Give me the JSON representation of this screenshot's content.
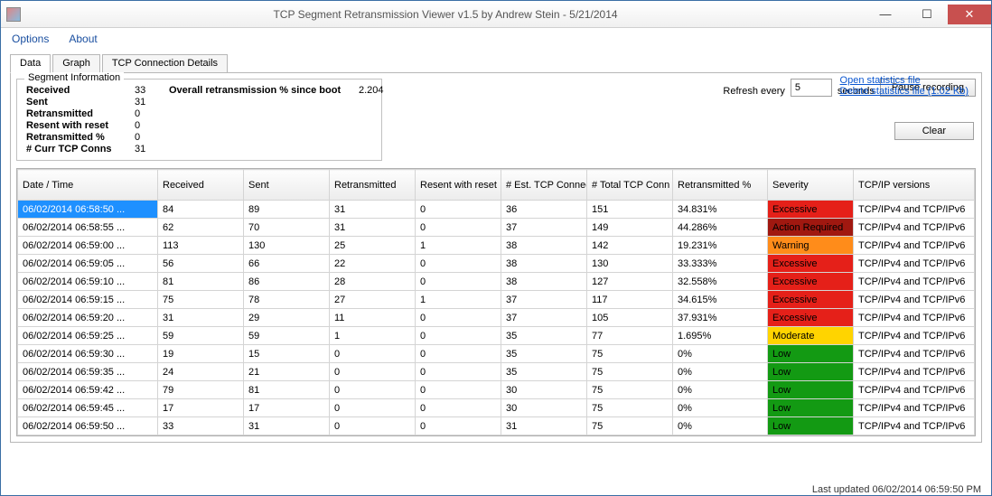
{
  "window": {
    "title": "TCP Segment Retransmission Viewer v1.5 by Andrew Stein - 5/21/2014"
  },
  "menu": {
    "options": "Options",
    "about": "About"
  },
  "tabs": {
    "data": "Data",
    "graph": "Graph",
    "details": "TCP Connection Details"
  },
  "segment_info": {
    "legend": "Segment Information",
    "labels": {
      "received": "Received",
      "sent": "Sent",
      "retransmitted": "Retransmitted",
      "resent_reset": "Resent with reset",
      "retrans_pct": "Retransmitted %",
      "curr_conns": "# Curr TCP Conns",
      "overall": "Overall retransmission % since boot"
    },
    "values": {
      "received": "33",
      "sent": "31",
      "retransmitted": "0",
      "resent_reset": "0",
      "retrans_pct": "0",
      "curr_conns": "31",
      "overall": "2.204"
    }
  },
  "refresh": {
    "label_pre": "Refresh every",
    "value": "5",
    "label_post": "seconds",
    "pause": "Pause recording"
  },
  "links": {
    "open": "Open statistics file",
    "delete": "Delete statistics file (1.02 Kb)"
  },
  "buttons": {
    "clear": "Clear"
  },
  "columns": {
    "dt": "Date / Time",
    "rx": "Received",
    "tx": "Sent",
    "rt": "Retransmitted",
    "rr": "Resent with reset",
    "ec": "# Est. TCP Connections",
    "tc": "# Total TCP Conn",
    "pct": "Retransmitted %",
    "sev": "Severity",
    "ver": "TCP/IP versions"
  },
  "rows": [
    {
      "dt": "06/02/2014 06:58:50 ...",
      "rx": "84",
      "tx": "89",
      "rt": "31",
      "rr": "0",
      "ec": "36",
      "tc": "151",
      "pct": "34.831%",
      "sev": "Excessive",
      "sev_cls": "Excessive",
      "ver": "TCP/IPv4 and TCP/IPv6",
      "sel": true
    },
    {
      "dt": "06/02/2014 06:58:55 ...",
      "rx": "62",
      "tx": "70",
      "rt": "31",
      "rr": "0",
      "ec": "37",
      "tc": "149",
      "pct": "44.286%",
      "sev": "Action Required",
      "sev_cls": "Action",
      "ver": "TCP/IPv4 and TCP/IPv6"
    },
    {
      "dt": "06/02/2014 06:59:00 ...",
      "rx": "113",
      "tx": "130",
      "rt": "25",
      "rr": "1",
      "ec": "38",
      "tc": "142",
      "pct": "19.231%",
      "sev": "Warning",
      "sev_cls": "Warning",
      "ver": "TCP/IPv4 and TCP/IPv6"
    },
    {
      "dt": "06/02/2014 06:59:05 ...",
      "rx": "56",
      "tx": "66",
      "rt": "22",
      "rr": "0",
      "ec": "38",
      "tc": "130",
      "pct": "33.333%",
      "sev": "Excessive",
      "sev_cls": "Excessive",
      "ver": "TCP/IPv4 and TCP/IPv6"
    },
    {
      "dt": "06/02/2014 06:59:10 ...",
      "rx": "81",
      "tx": "86",
      "rt": "28",
      "rr": "0",
      "ec": "38",
      "tc": "127",
      "pct": "32.558%",
      "sev": "Excessive",
      "sev_cls": "Excessive",
      "ver": "TCP/IPv4 and TCP/IPv6"
    },
    {
      "dt": "06/02/2014 06:59:15 ...",
      "rx": "75",
      "tx": "78",
      "rt": "27",
      "rr": "1",
      "ec": "37",
      "tc": "117",
      "pct": "34.615%",
      "sev": "Excessive",
      "sev_cls": "Excessive",
      "ver": "TCP/IPv4 and TCP/IPv6"
    },
    {
      "dt": "06/02/2014 06:59:20 ...",
      "rx": "31",
      "tx": "29",
      "rt": "11",
      "rr": "0",
      "ec": "37",
      "tc": "105",
      "pct": "37.931%",
      "sev": "Excessive",
      "sev_cls": "Excessive",
      "ver": "TCP/IPv4 and TCP/IPv6"
    },
    {
      "dt": "06/02/2014 06:59:25 ...",
      "rx": "59",
      "tx": "59",
      "rt": "1",
      "rr": "0",
      "ec": "35",
      "tc": "77",
      "pct": "1.695%",
      "sev": "Moderate",
      "sev_cls": "Moderate",
      "ver": "TCP/IPv4 and TCP/IPv6"
    },
    {
      "dt": "06/02/2014 06:59:30 ...",
      "rx": "19",
      "tx": "15",
      "rt": "0",
      "rr": "0",
      "ec": "35",
      "tc": "75",
      "pct": "0%",
      "sev": "Low",
      "sev_cls": "Low",
      "ver": "TCP/IPv4 and TCP/IPv6"
    },
    {
      "dt": "06/02/2014 06:59:35 ...",
      "rx": "24",
      "tx": "21",
      "rt": "0",
      "rr": "0",
      "ec": "35",
      "tc": "75",
      "pct": "0%",
      "sev": "Low",
      "sev_cls": "Low",
      "ver": "TCP/IPv4 and TCP/IPv6"
    },
    {
      "dt": "06/02/2014 06:59:42 ...",
      "rx": "79",
      "tx": "81",
      "rt": "0",
      "rr": "0",
      "ec": "30",
      "tc": "75",
      "pct": "0%",
      "sev": "Low",
      "sev_cls": "Low",
      "ver": "TCP/IPv4 and TCP/IPv6"
    },
    {
      "dt": "06/02/2014 06:59:45 ...",
      "rx": "17",
      "tx": "17",
      "rt": "0",
      "rr": "0",
      "ec": "30",
      "tc": "75",
      "pct": "0%",
      "sev": "Low",
      "sev_cls": "Low",
      "ver": "TCP/IPv4 and TCP/IPv6"
    },
    {
      "dt": "06/02/2014 06:59:50 ...",
      "rx": "33",
      "tx": "31",
      "rt": "0",
      "rr": "0",
      "ec": "31",
      "tc": "75",
      "pct": "0%",
      "sev": "Low",
      "sev_cls": "Low",
      "ver": "TCP/IPv4 and TCP/IPv6"
    }
  ],
  "status": {
    "last_updated": "Last updated 06/02/2014 06:59:50 PM"
  }
}
